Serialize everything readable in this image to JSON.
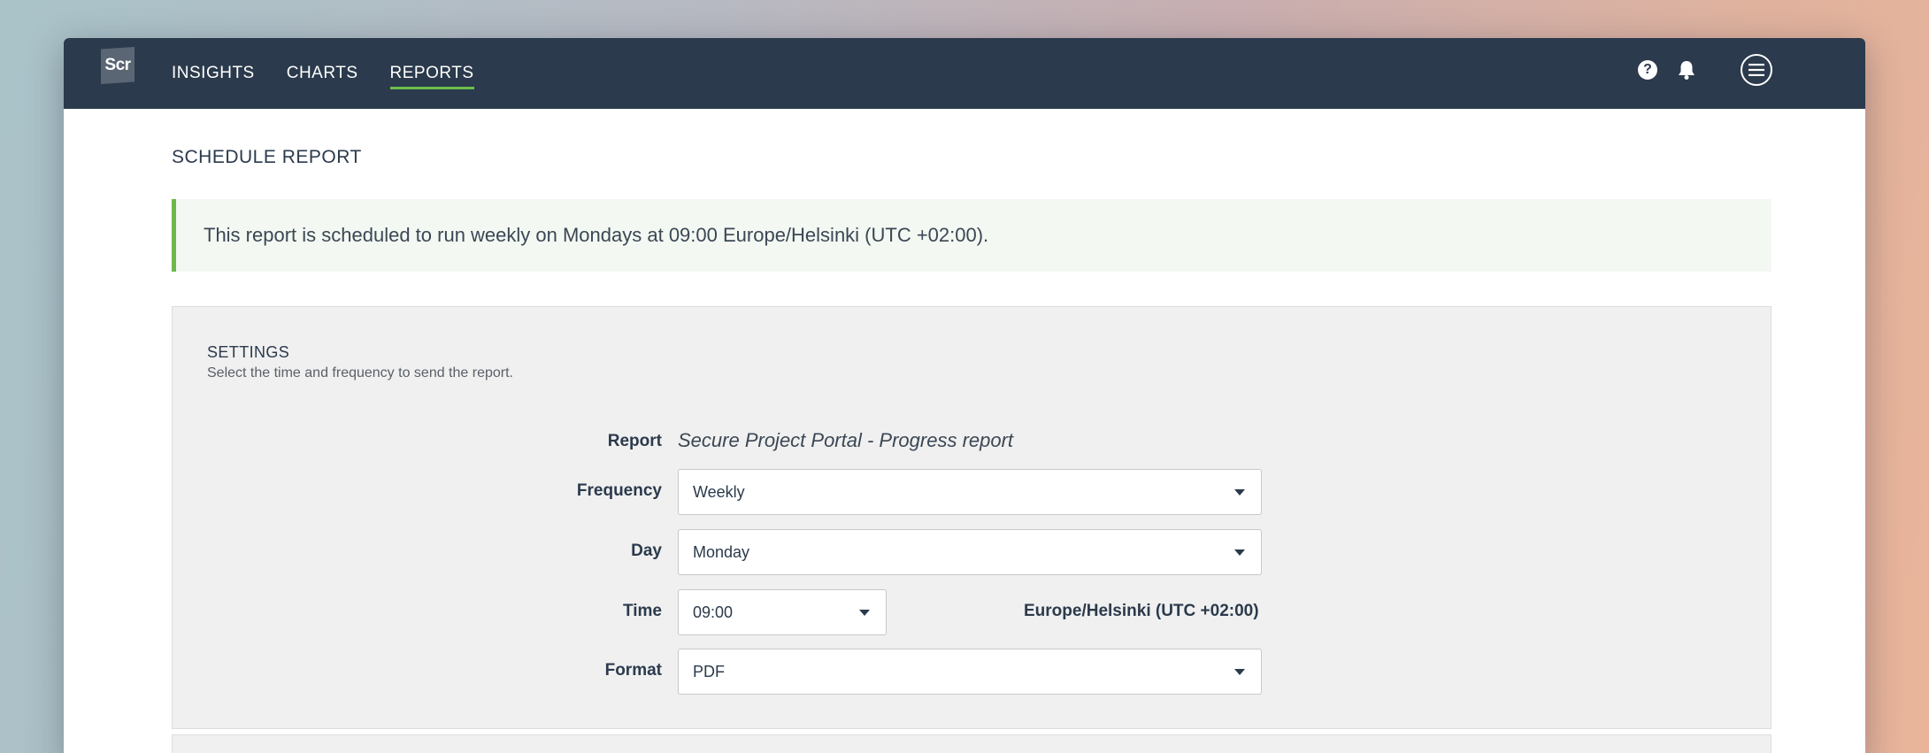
{
  "nav": {
    "logo_text": "Scr",
    "items": [
      {
        "label": "INSIGHTS",
        "active": false
      },
      {
        "label": "CHARTS",
        "active": false
      },
      {
        "label": "REPORTS",
        "active": true
      }
    ],
    "icons": [
      "help-icon",
      "bell-icon",
      "menu-icon"
    ]
  },
  "page": {
    "title": "SCHEDULE REPORT",
    "alert": "This report is scheduled to run weekly on Mondays at 09:00 Europe/Helsinki (UTC +02:00)."
  },
  "settings": {
    "title": "SETTINGS",
    "subtitle": "Select the time and frequency to send the report.",
    "report_label": "Report",
    "report_value": "Secure Project Portal - Progress report",
    "frequency_label": "Frequency",
    "frequency_value": "Weekly",
    "day_label": "Day",
    "day_value": "Monday",
    "time_label": "Time",
    "time_value": "09:00",
    "timezone": "Europe/Helsinki (UTC +02:00)",
    "format_label": "Format",
    "format_value": "PDF"
  },
  "colors": {
    "topbar": "#2b3a4c",
    "accent": "#6cc04a",
    "alert_bg": "#f3f8f2",
    "panel_bg": "#f0f0f0"
  }
}
